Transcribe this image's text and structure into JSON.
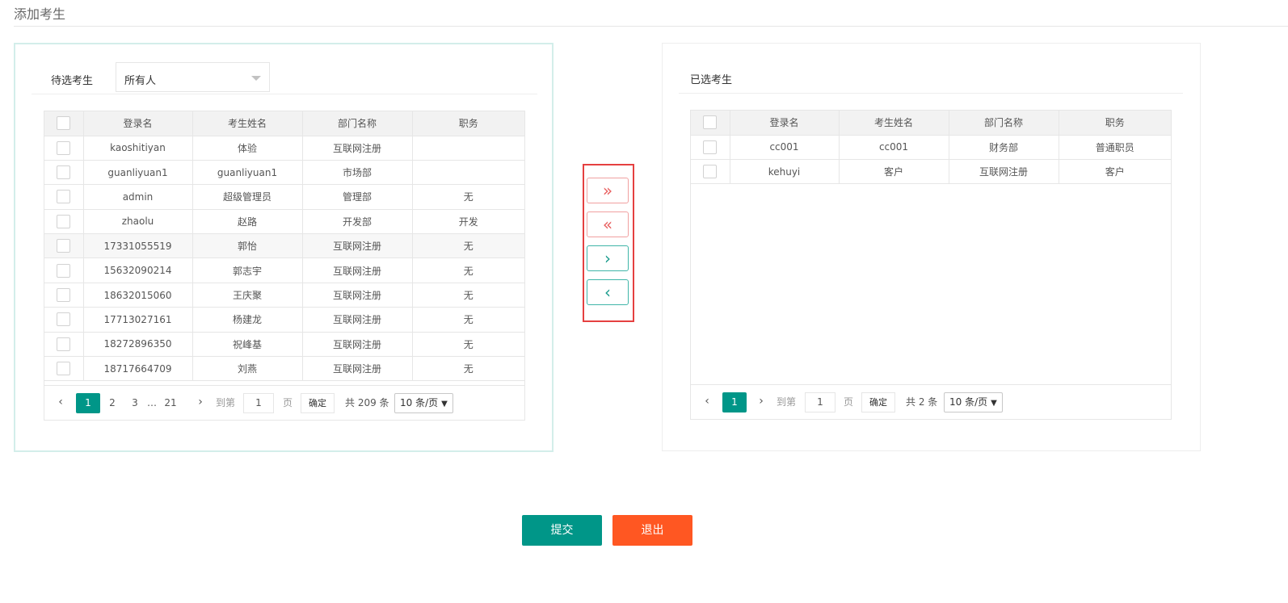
{
  "page": {
    "title": "添加考生"
  },
  "left_panel": {
    "label": "待选考生",
    "filter": {
      "selected": "所有人"
    },
    "columns": [
      "登录名",
      "考生姓名",
      "部门名称",
      "职务"
    ],
    "rows": [
      [
        "kaoshitiyan",
        "体验",
        "互联网注册",
        ""
      ],
      [
        "guanliyuan1",
        "guanliyuan1",
        "市场部",
        ""
      ],
      [
        "admin",
        "超级管理员",
        "管理部",
        "无"
      ],
      [
        "zhaolu",
        "赵路",
        "开发部",
        "开发"
      ],
      [
        "17331055519",
        "郭怡",
        "互联网注册",
        "无"
      ],
      [
        "15632090214",
        "郭志宇",
        "互联网注册",
        "无"
      ],
      [
        "18632015060",
        "王庆聚",
        "互联网注册",
        "无"
      ],
      [
        "17713027161",
        "杨建龙",
        "互联网注册",
        "无"
      ],
      [
        "18272896350",
        "祝峰基",
        "互联网注册",
        "无"
      ],
      [
        "18717664709",
        "刘燕",
        "互联网注册",
        "无"
      ]
    ],
    "pager": {
      "prev": "‹",
      "next": "›",
      "pages": [
        "1",
        "2",
        "3",
        "…",
        "21"
      ],
      "goto_label": "到第",
      "goto_value": "1",
      "page_unit": "页",
      "confirm": "确定",
      "total": "共 209 条",
      "page_size": "10 条/页"
    }
  },
  "right_panel": {
    "label": "已选考生",
    "columns": [
      "登录名",
      "考生姓名",
      "部门名称",
      "职务"
    ],
    "rows": [
      [
        "cc001",
        "cc001",
        "财务部",
        "普通职员"
      ],
      [
        "kehuyi",
        "客户",
        "互联网注册",
        "客户"
      ]
    ],
    "pager": {
      "prev": "‹",
      "next": "›",
      "pages": [
        "1"
      ],
      "goto_label": "到第",
      "goto_value": "1",
      "page_unit": "页",
      "confirm": "确定",
      "total": "共 2 条",
      "page_size": "10 条/页"
    }
  },
  "transfer": {
    "move_all_right": "»",
    "move_all_left": "«",
    "move_right": "›",
    "move_left": "‹"
  },
  "actions": {
    "submit": "提交",
    "exit": "退出"
  },
  "colors": {
    "primary": "#009688",
    "danger": "#ff5722",
    "highlight_border": "#e54040"
  }
}
